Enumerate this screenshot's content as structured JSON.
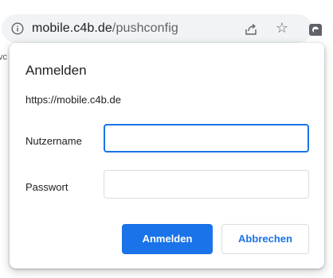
{
  "browser": {
    "url_host": "mobile.c4b.de",
    "url_path": "/pushconfig",
    "page_edge_text": "vc"
  },
  "dialog": {
    "title": "Anmelden",
    "origin": "https://mobile.c4b.de",
    "username": {
      "label": "Nutzername",
      "value": ""
    },
    "password": {
      "label": "Passwort",
      "value": ""
    },
    "submit_label": "Anmelden",
    "cancel_label": "Abbrechen"
  },
  "colors": {
    "accent": "#1a73e8"
  }
}
